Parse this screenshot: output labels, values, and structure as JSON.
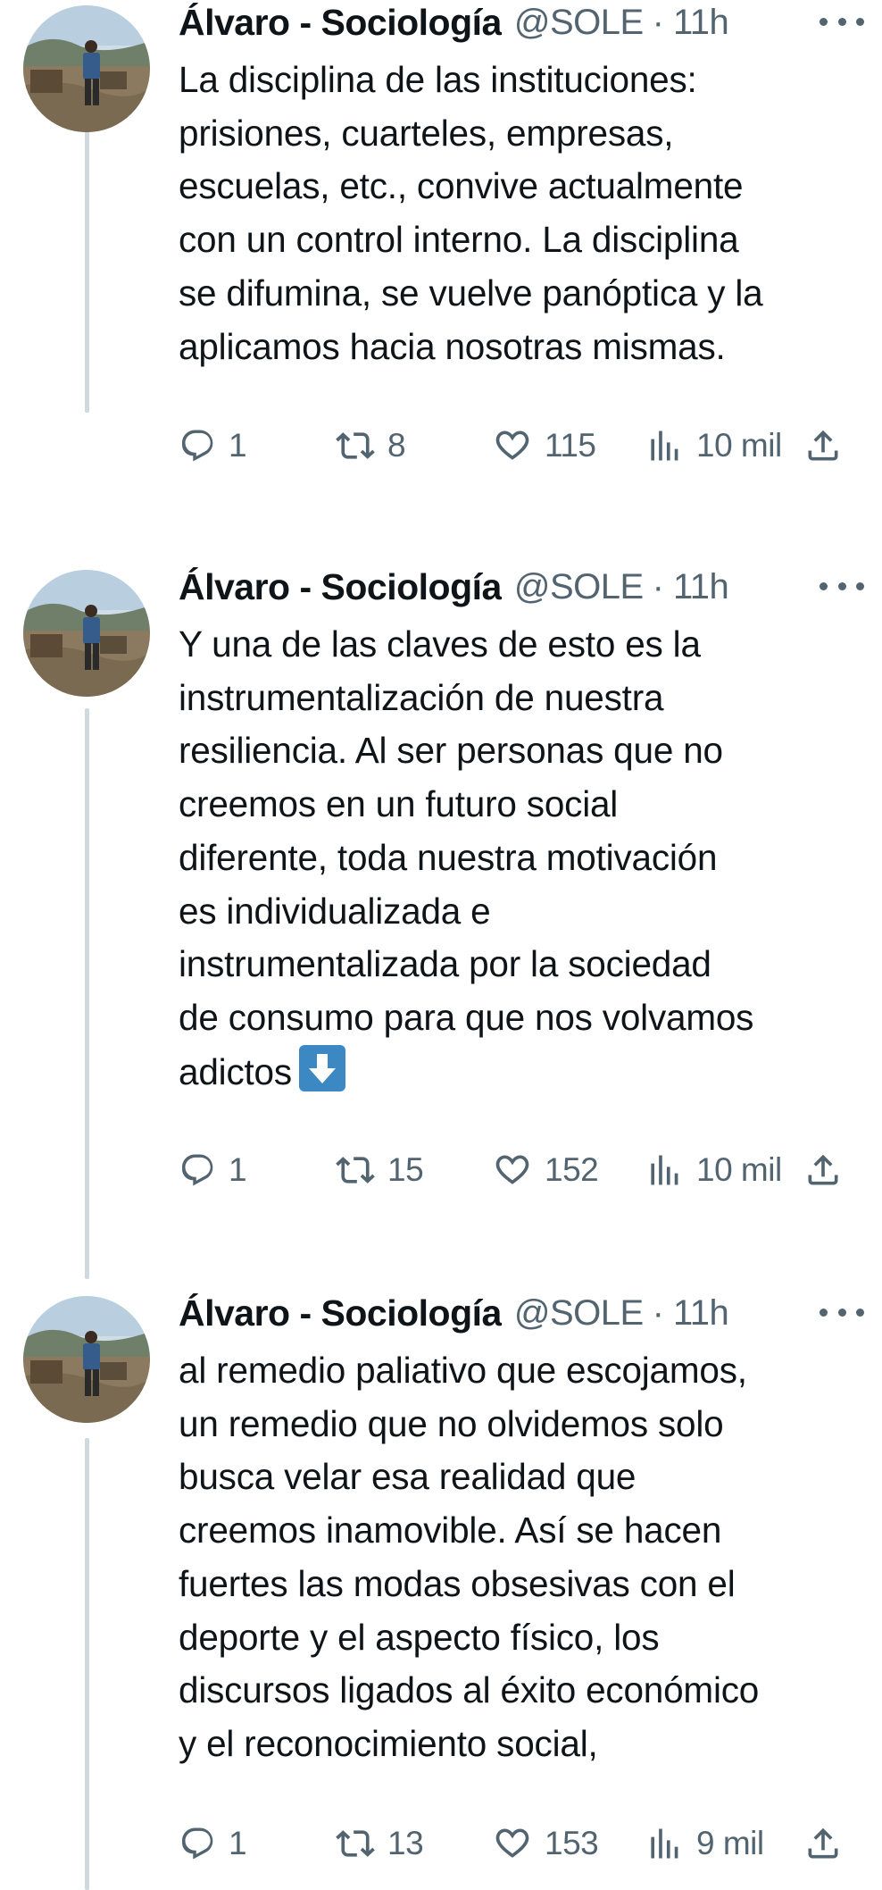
{
  "tweets": [
    {
      "name": "Álvaro - Sociología",
      "handle": "@SOLE",
      "separator": "·",
      "time": "11h",
      "lines": [
        "La disciplina de las instituciones:",
        "prisiones, cuarteles, empresas,",
        "escuelas, etc., convive actualmente",
        "con un control interno. La disciplina",
        "se difumina, se vuelve panóptica y la",
        "aplicamos hacia nosotras mismas."
      ],
      "has_emoji": false,
      "replies": "1",
      "retweets": "8",
      "likes": "115",
      "views": "10 mil"
    },
    {
      "name": "Álvaro - Sociología",
      "handle": "@SOLE",
      "separator": "·",
      "time": "11h",
      "lines": [
        "Y una de las claves de esto es la",
        "instrumentalización de nuestra",
        "resiliencia. Al ser personas que no",
        "creemos en un futuro social",
        "diferente, toda nuestra motivación",
        "es individualizada e",
        "instrumentalizada por la sociedad",
        "de consumo para que nos volvamos",
        "adictos"
      ],
      "has_emoji": true,
      "emoji_name": "down-arrow-emoji",
      "replies": "1",
      "retweets": "15",
      "likes": "152",
      "views": "10 mil"
    },
    {
      "name": "Álvaro - Sociología",
      "handle": "@SOLE",
      "separator": "·",
      "time": "11h",
      "lines": [
        "al remedio paliativo que escojamos,",
        "un remedio que no olvidemos solo",
        "busca velar esa realidad que",
        "creemos inamovible. Así se hacen",
        "fuertes las modas obsesivas con el",
        "deporte y el aspecto físico, los",
        "discursos ligados al éxito económico",
        "y el reconocimiento social,"
      ],
      "has_emoji": false,
      "replies": "1",
      "retweets": "13",
      "likes": "153",
      "views": "9 mil"
    }
  ],
  "icons": {
    "reply": "reply-icon",
    "retweet": "retweet-icon",
    "like": "heart-icon",
    "views": "views-chart-icon",
    "share": "share-icon",
    "more": "more-options-icon"
  },
  "colors": {
    "text": "#0f1419",
    "secondary": "#536471",
    "thread_line": "#cfd9de",
    "emoji_bg": "#3b88c3"
  }
}
